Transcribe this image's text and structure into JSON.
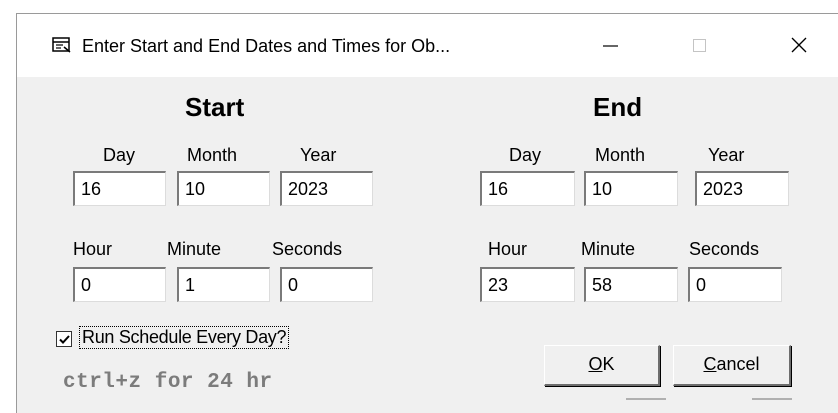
{
  "window": {
    "title": "Enter Start and End Dates and Times for Ob..."
  },
  "start": {
    "heading": "Start",
    "date_labels": [
      "Day",
      "Month",
      "Year"
    ],
    "time_labels": [
      "Hour",
      "Minute",
      "Seconds"
    ],
    "day": "16",
    "month": "10",
    "year": "2023",
    "hour": "0",
    "minute": "1",
    "seconds": "0"
  },
  "end": {
    "heading": "End",
    "date_labels": [
      "Day",
      "Month",
      "Year"
    ],
    "time_labels": [
      "Hour",
      "Minute",
      "Seconds"
    ],
    "day": "16",
    "month": "10",
    "year": "2023",
    "hour": "23",
    "minute": "58",
    "seconds": "0"
  },
  "schedule": {
    "checkbox_label": "Run Schedule Every Day?",
    "checked": true
  },
  "hint": "ctrl+z for 24 hr",
  "buttons": {
    "ok_access": "O",
    "ok_rest": "K",
    "cancel_access": "C",
    "cancel_rest": "ancel"
  },
  "icons": {
    "title": "window-icon",
    "minimize": "minimize-icon",
    "maximize": "maximize-icon",
    "close": "close-icon",
    "check": "check-icon"
  }
}
